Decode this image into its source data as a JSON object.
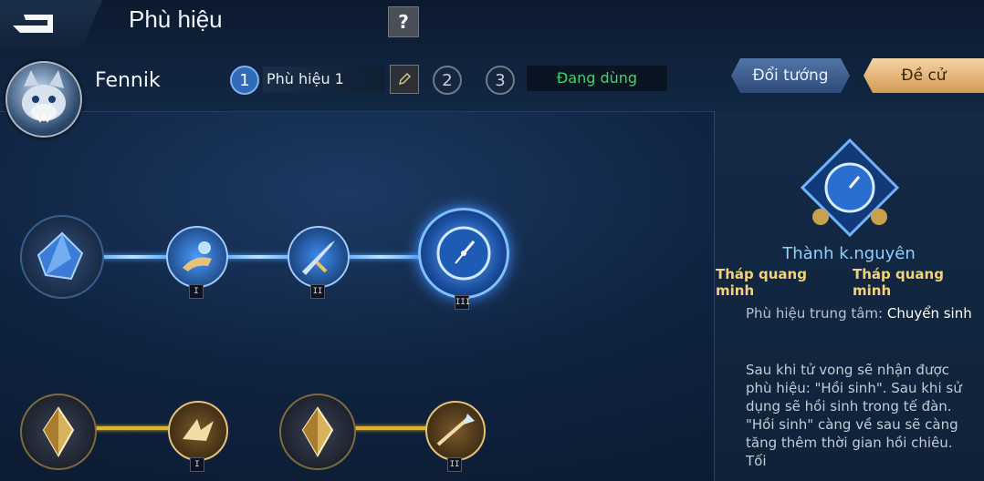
{
  "header": {
    "title": "Phù hiệu",
    "help": "?"
  },
  "hero": {
    "name": "Fennik"
  },
  "sets": [
    {
      "number": "1",
      "name": "Phù hiệu 1",
      "active": true
    },
    {
      "number": "2"
    },
    {
      "number": "3"
    }
  ],
  "status": "Đang dùng",
  "buttons": {
    "change_hero": "Đổi tướng",
    "recommend": "Đề cử"
  },
  "tree": {
    "blue_path": [
      {
        "tier": ""
      },
      {
        "tier": "I"
      },
      {
        "tier": "II"
      },
      {
        "tier": "III"
      }
    ],
    "gold_path": [
      {
        "tier": ""
      },
      {
        "tier": "I"
      },
      {
        "tier": ""
      },
      {
        "tier": "II"
      }
    ]
  },
  "detail": {
    "name": "Thành k.nguyên",
    "requirements": [
      "Tháp quang minh",
      "Tháp quang minh"
    ],
    "core_label": "Phù hiệu trung tâm: ",
    "core_value": "Chuyển sinh",
    "description": "Sau khi tử vong sẽ nhận được phù hiệu: \"Hồi sinh\". Sau khi sử dụng sẽ hồi sinh trong tế đàn. \"Hồi sinh\" càng về sau sẽ càng tăng thêm thời gian hồi chiêu. Tối"
  },
  "colors": {
    "accent_blue": "#3f8cff",
    "gold": "#e0b52a",
    "in_use_green": "#3fd46b"
  }
}
